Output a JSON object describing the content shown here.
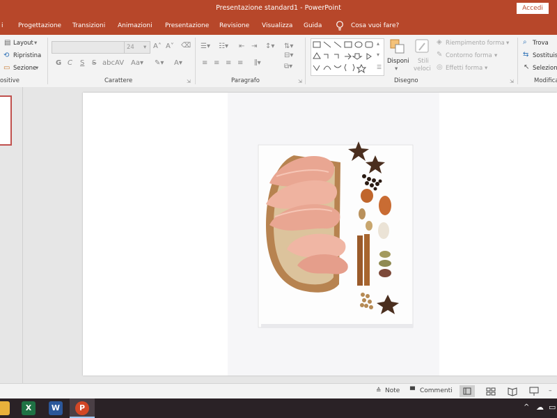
{
  "window": {
    "title": "Presentazione standard1  -  PowerPoint",
    "signin_label": "Accedi"
  },
  "tabs": [
    "i",
    "Progettazione",
    "Transizioni",
    "Animazioni",
    "Presentazione",
    "Revisione",
    "Visualizza",
    "Guida",
    "Cosa vuoi fare?"
  ],
  "ribbon": {
    "slides": {
      "layout": "Layout",
      "reset": "Ripristina",
      "section": "Sezione",
      "label": "ositive"
    },
    "font": {
      "size": "24",
      "bold": "G",
      "italic": "C",
      "underline": "S",
      "strike": "S",
      "label": "Carattere"
    },
    "paragraph": {
      "label": "Paragrafo"
    },
    "drawing": {
      "arrange": "Disponi",
      "quick_styles_1": "Stili",
      "quick_styles_2": "veloci",
      "fill": "Riempimento forma",
      "outline": "Contorno forma",
      "effects": "Effetti forma",
      "label": "Disegno"
    },
    "editing": {
      "find": "Trova",
      "replace": "Sostituisci",
      "select": "Seleziona",
      "label": "Modifica"
    }
  },
  "status": {
    "notes": "Note",
    "comments": "Commenti"
  },
  "colors": {
    "accent": "#b7472a",
    "ribbon": "#f3f3f3"
  },
  "taskbar_apps": [
    "file-explorer-icon",
    "excel-icon",
    "word-icon",
    "powerpoint-icon"
  ]
}
